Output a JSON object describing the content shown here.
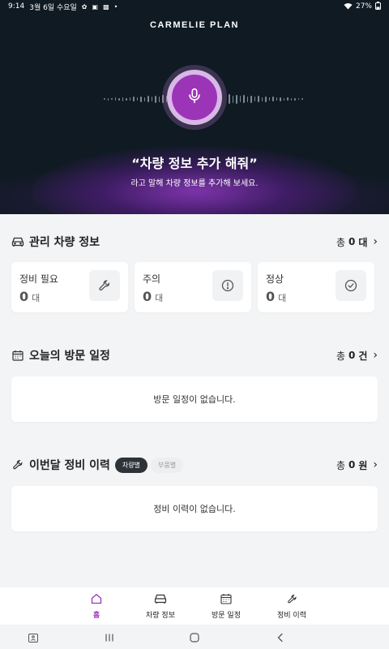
{
  "status_bar": {
    "time": "9:14",
    "date": "3월 6일 수요일",
    "battery": "27%"
  },
  "hero": {
    "brand": "CARMELIE PLAN",
    "quote": "“차량 정보 추가 해줘”",
    "subtitle": "라고 말해 차량 정보를 추가해 보세요.",
    "accent_color": "#9c34b8"
  },
  "vehicles": {
    "title": "관리 차량 정보",
    "total_prefix": "총",
    "total_count": "0",
    "total_unit": "대",
    "cards": [
      {
        "label": "정비 필요",
        "value": "0",
        "unit": "대",
        "icon": "wrench-icon"
      },
      {
        "label": "주의",
        "value": "0",
        "unit": "대",
        "icon": "alert-circle-icon"
      },
      {
        "label": "정상",
        "value": "0",
        "unit": "대",
        "icon": "check-circle-icon"
      }
    ]
  },
  "visits": {
    "title": "오늘의 방문 일정",
    "total_prefix": "총",
    "total_count": "0",
    "total_unit": "건",
    "empty_text": "방문 일정이 없습니다."
  },
  "history": {
    "title": "이번달 정비 이력",
    "chip_active": "차량별",
    "chip_inactive": "부품별",
    "total_prefix": "총",
    "total_count": "0",
    "total_unit": "원",
    "empty_text": "정비 이력이 없습니다."
  },
  "bottom_nav": {
    "items": [
      {
        "label": "홈",
        "icon": "home-icon",
        "active": true
      },
      {
        "label": "차량 정보",
        "icon": "car-icon",
        "active": false
      },
      {
        "label": "방문 일정",
        "icon": "calendar-icon",
        "active": false
      },
      {
        "label": "정비 이력",
        "icon": "wrench-icon",
        "active": false
      }
    ]
  }
}
